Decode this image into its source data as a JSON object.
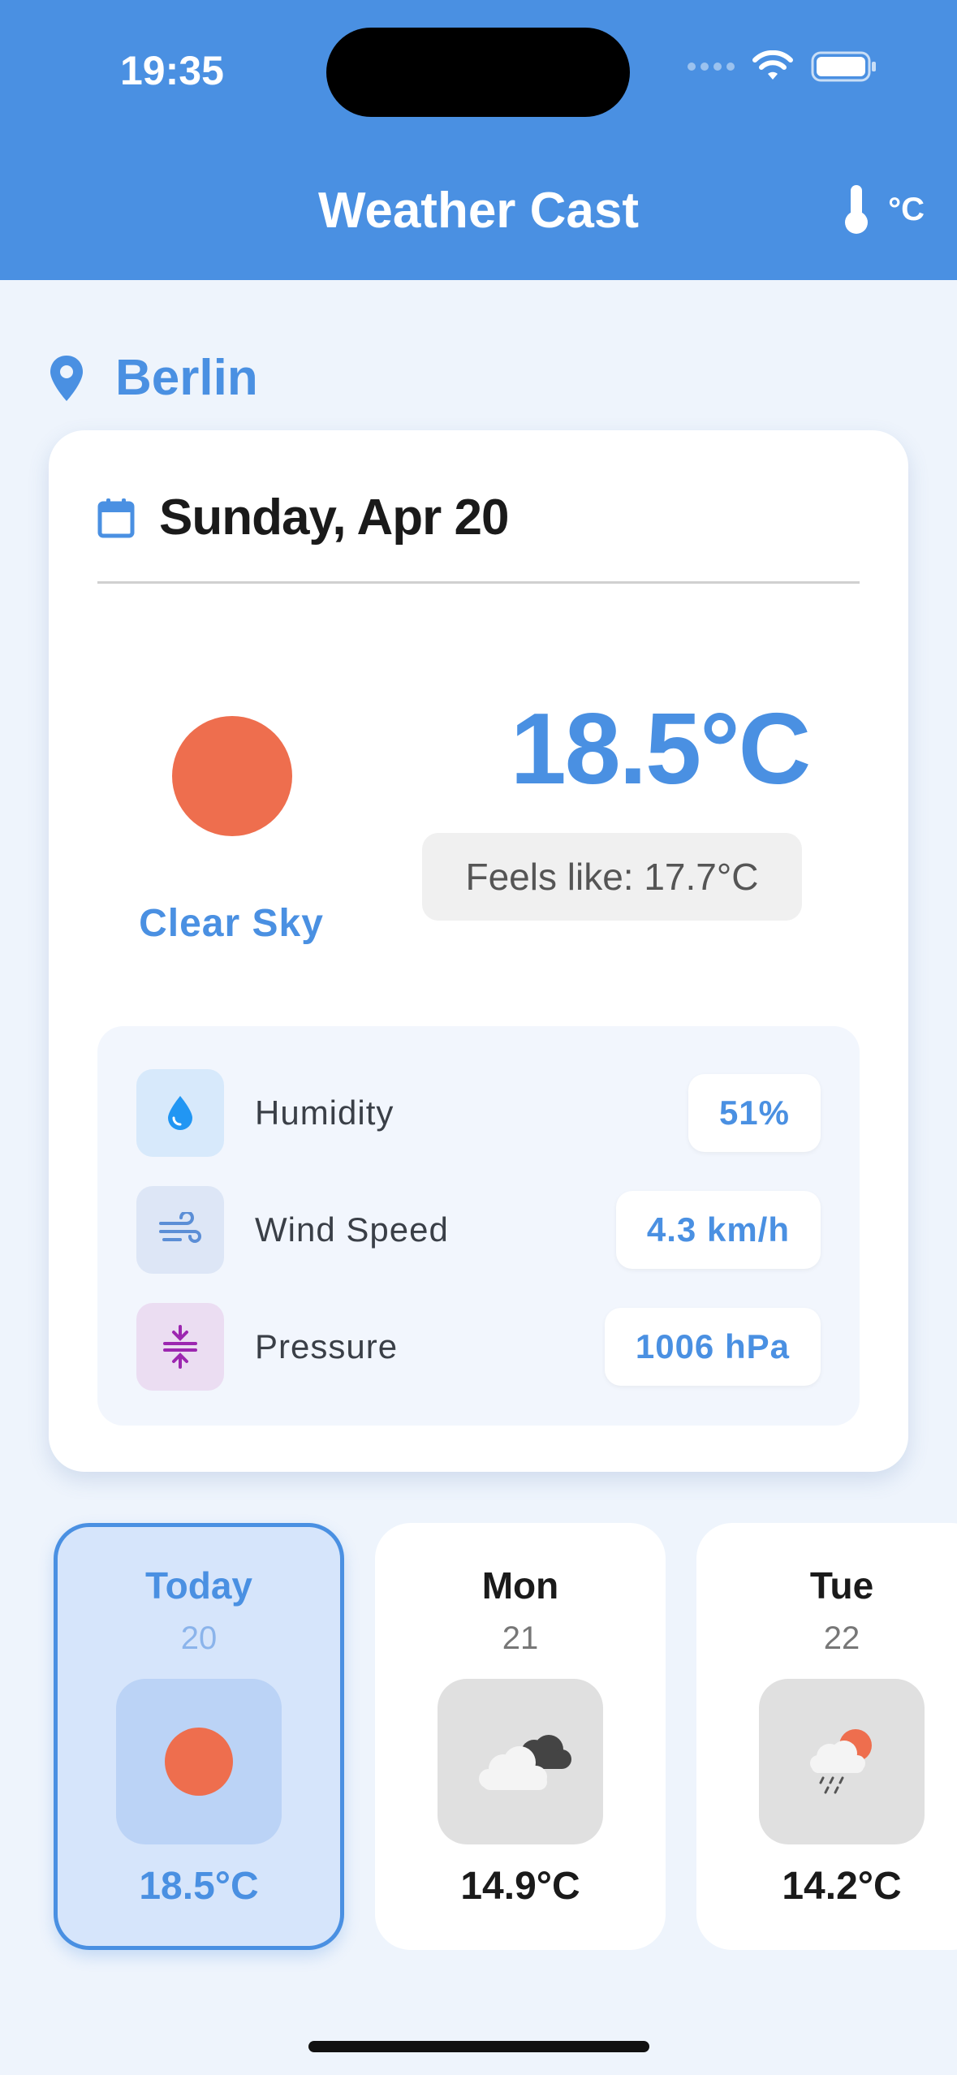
{
  "status": {
    "time": "19:35"
  },
  "header": {
    "title": "Weather Cast",
    "unit": "°C"
  },
  "location": {
    "name": "Berlin"
  },
  "current": {
    "date": "Sunday, Apr 20",
    "temperature": "18.5°C",
    "feels_like": "Feels like: 17.7°C",
    "condition": "Clear Sky",
    "stats": [
      {
        "label": "Humidity",
        "value": "51%",
        "icon": "water-drop-icon"
      },
      {
        "label": "Wind Speed",
        "value": "4.3 km/h",
        "icon": "wind-icon"
      },
      {
        "label": "Pressure",
        "value": "1006 hPa",
        "icon": "compress-icon"
      }
    ]
  },
  "forecast": [
    {
      "day": "Today",
      "date": "20",
      "temp": "18.5°C",
      "icon": "sun-icon",
      "selected": true
    },
    {
      "day": "Mon",
      "date": "21",
      "temp": "14.9°C",
      "icon": "cloudy-icon",
      "selected": false
    },
    {
      "day": "Tue",
      "date": "22",
      "temp": "14.2°C",
      "icon": "sun-rain-icon",
      "selected": false
    }
  ],
  "colors": {
    "primary": "#4A90E2",
    "background": "#EEF4FC",
    "sun": "#EE6E4E"
  }
}
